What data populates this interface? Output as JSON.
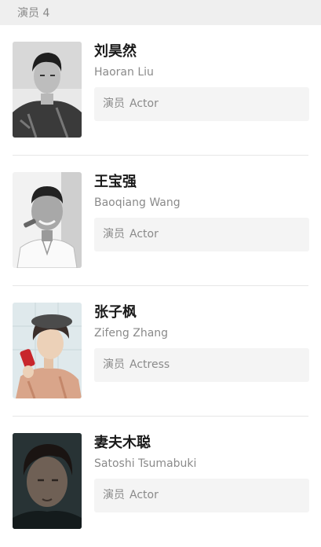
{
  "header": {
    "title": "演员 4"
  },
  "cast": [
    {
      "name_cn": "刘昊然",
      "name_en": "Haoran Liu",
      "role_label": "演员",
      "role": "Actor"
    },
    {
      "name_cn": "王宝强",
      "name_en": "Baoqiang Wang",
      "role_label": "演员",
      "role": "Actor"
    },
    {
      "name_cn": "张子枫",
      "name_en": "Zifeng Zhang",
      "role_label": "演员",
      "role": "Actress"
    },
    {
      "name_cn": "妻夫木聪",
      "name_en": "Satoshi Tsumabuki",
      "role_label": "演员",
      "role": "Actor"
    }
  ]
}
